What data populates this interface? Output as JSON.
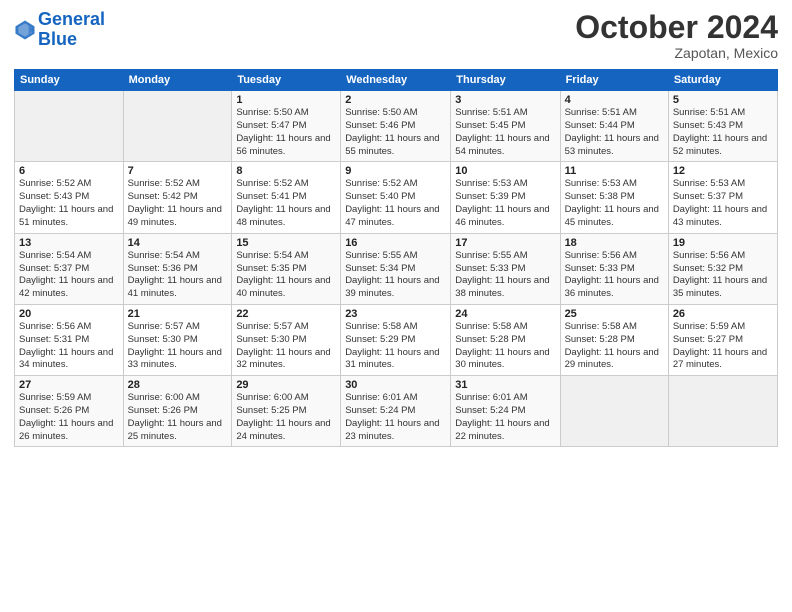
{
  "header": {
    "logo_line1": "General",
    "logo_line2": "Blue",
    "month": "October 2024",
    "location": "Zapotan, Mexico"
  },
  "weekdays": [
    "Sunday",
    "Monday",
    "Tuesday",
    "Wednesday",
    "Thursday",
    "Friday",
    "Saturday"
  ],
  "weeks": [
    [
      {
        "day": "",
        "empty": true
      },
      {
        "day": "",
        "empty": true
      },
      {
        "day": "1",
        "sunrise": "Sunrise: 5:50 AM",
        "sunset": "Sunset: 5:47 PM",
        "daylight": "Daylight: 11 hours and 56 minutes."
      },
      {
        "day": "2",
        "sunrise": "Sunrise: 5:50 AM",
        "sunset": "Sunset: 5:46 PM",
        "daylight": "Daylight: 11 hours and 55 minutes."
      },
      {
        "day": "3",
        "sunrise": "Sunrise: 5:51 AM",
        "sunset": "Sunset: 5:45 PM",
        "daylight": "Daylight: 11 hours and 54 minutes."
      },
      {
        "day": "4",
        "sunrise": "Sunrise: 5:51 AM",
        "sunset": "Sunset: 5:44 PM",
        "daylight": "Daylight: 11 hours and 53 minutes."
      },
      {
        "day": "5",
        "sunrise": "Sunrise: 5:51 AM",
        "sunset": "Sunset: 5:43 PM",
        "daylight": "Daylight: 11 hours and 52 minutes."
      }
    ],
    [
      {
        "day": "6",
        "sunrise": "Sunrise: 5:52 AM",
        "sunset": "Sunset: 5:43 PM",
        "daylight": "Daylight: 11 hours and 51 minutes."
      },
      {
        "day": "7",
        "sunrise": "Sunrise: 5:52 AM",
        "sunset": "Sunset: 5:42 PM",
        "daylight": "Daylight: 11 hours and 49 minutes."
      },
      {
        "day": "8",
        "sunrise": "Sunrise: 5:52 AM",
        "sunset": "Sunset: 5:41 PM",
        "daylight": "Daylight: 11 hours and 48 minutes."
      },
      {
        "day": "9",
        "sunrise": "Sunrise: 5:52 AM",
        "sunset": "Sunset: 5:40 PM",
        "daylight": "Daylight: 11 hours and 47 minutes."
      },
      {
        "day": "10",
        "sunrise": "Sunrise: 5:53 AM",
        "sunset": "Sunset: 5:39 PM",
        "daylight": "Daylight: 11 hours and 46 minutes."
      },
      {
        "day": "11",
        "sunrise": "Sunrise: 5:53 AM",
        "sunset": "Sunset: 5:38 PM",
        "daylight": "Daylight: 11 hours and 45 minutes."
      },
      {
        "day": "12",
        "sunrise": "Sunrise: 5:53 AM",
        "sunset": "Sunset: 5:37 PM",
        "daylight": "Daylight: 11 hours and 43 minutes."
      }
    ],
    [
      {
        "day": "13",
        "sunrise": "Sunrise: 5:54 AM",
        "sunset": "Sunset: 5:37 PM",
        "daylight": "Daylight: 11 hours and 42 minutes."
      },
      {
        "day": "14",
        "sunrise": "Sunrise: 5:54 AM",
        "sunset": "Sunset: 5:36 PM",
        "daylight": "Daylight: 11 hours and 41 minutes."
      },
      {
        "day": "15",
        "sunrise": "Sunrise: 5:54 AM",
        "sunset": "Sunset: 5:35 PM",
        "daylight": "Daylight: 11 hours and 40 minutes."
      },
      {
        "day": "16",
        "sunrise": "Sunrise: 5:55 AM",
        "sunset": "Sunset: 5:34 PM",
        "daylight": "Daylight: 11 hours and 39 minutes."
      },
      {
        "day": "17",
        "sunrise": "Sunrise: 5:55 AM",
        "sunset": "Sunset: 5:33 PM",
        "daylight": "Daylight: 11 hours and 38 minutes."
      },
      {
        "day": "18",
        "sunrise": "Sunrise: 5:56 AM",
        "sunset": "Sunset: 5:33 PM",
        "daylight": "Daylight: 11 hours and 36 minutes."
      },
      {
        "day": "19",
        "sunrise": "Sunrise: 5:56 AM",
        "sunset": "Sunset: 5:32 PM",
        "daylight": "Daylight: 11 hours and 35 minutes."
      }
    ],
    [
      {
        "day": "20",
        "sunrise": "Sunrise: 5:56 AM",
        "sunset": "Sunset: 5:31 PM",
        "daylight": "Daylight: 11 hours and 34 minutes."
      },
      {
        "day": "21",
        "sunrise": "Sunrise: 5:57 AM",
        "sunset": "Sunset: 5:30 PM",
        "daylight": "Daylight: 11 hours and 33 minutes."
      },
      {
        "day": "22",
        "sunrise": "Sunrise: 5:57 AM",
        "sunset": "Sunset: 5:30 PM",
        "daylight": "Daylight: 11 hours and 32 minutes."
      },
      {
        "day": "23",
        "sunrise": "Sunrise: 5:58 AM",
        "sunset": "Sunset: 5:29 PM",
        "daylight": "Daylight: 11 hours and 31 minutes."
      },
      {
        "day": "24",
        "sunrise": "Sunrise: 5:58 AM",
        "sunset": "Sunset: 5:28 PM",
        "daylight": "Daylight: 11 hours and 30 minutes."
      },
      {
        "day": "25",
        "sunrise": "Sunrise: 5:58 AM",
        "sunset": "Sunset: 5:28 PM",
        "daylight": "Daylight: 11 hours and 29 minutes."
      },
      {
        "day": "26",
        "sunrise": "Sunrise: 5:59 AM",
        "sunset": "Sunset: 5:27 PM",
        "daylight": "Daylight: 11 hours and 27 minutes."
      }
    ],
    [
      {
        "day": "27",
        "sunrise": "Sunrise: 5:59 AM",
        "sunset": "Sunset: 5:26 PM",
        "daylight": "Daylight: 11 hours and 26 minutes."
      },
      {
        "day": "28",
        "sunrise": "Sunrise: 6:00 AM",
        "sunset": "Sunset: 5:26 PM",
        "daylight": "Daylight: 11 hours and 25 minutes."
      },
      {
        "day": "29",
        "sunrise": "Sunrise: 6:00 AM",
        "sunset": "Sunset: 5:25 PM",
        "daylight": "Daylight: 11 hours and 24 minutes."
      },
      {
        "day": "30",
        "sunrise": "Sunrise: 6:01 AM",
        "sunset": "Sunset: 5:24 PM",
        "daylight": "Daylight: 11 hours and 23 minutes."
      },
      {
        "day": "31",
        "sunrise": "Sunrise: 6:01 AM",
        "sunset": "Sunset: 5:24 PM",
        "daylight": "Daylight: 11 hours and 22 minutes."
      },
      {
        "day": "",
        "empty": true
      },
      {
        "day": "",
        "empty": true
      }
    ]
  ]
}
